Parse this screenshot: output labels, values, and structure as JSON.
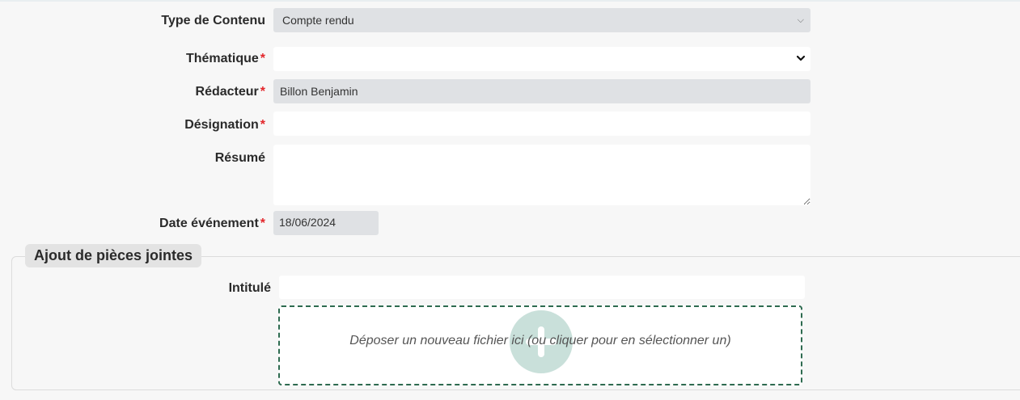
{
  "form": {
    "type_contenu": {
      "label": "Type de Contenu",
      "value": "Compte rendu"
    },
    "thematique": {
      "label": "Thématique",
      "required_mark": "*",
      "value": ""
    },
    "redacteur": {
      "label": "Rédacteur",
      "required_mark": "*",
      "value": "Billon Benjamin"
    },
    "designation": {
      "label": "Désignation",
      "required_mark": "*",
      "value": ""
    },
    "resume": {
      "label": "Résumé",
      "value": ""
    },
    "date_evenement": {
      "label": "Date événement",
      "required_mark": "*",
      "value": "18/06/2024"
    }
  },
  "attachments": {
    "legend": "Ajout de pièces jointes",
    "intitule": {
      "label": "Intitulé",
      "value": ""
    },
    "dropzone_text": "Déposer un nouveau fichier ici (ou cliquer pour en sélectionner un)"
  },
  "icons": {
    "select_chevron": "chevron-down-icon",
    "add": "plus-icon"
  },
  "colors": {
    "required": "#e3262b",
    "readonly_field": "#dfe1e4",
    "dropzone_border": "#2e6b50",
    "plus_circle": "#c9e0da"
  }
}
